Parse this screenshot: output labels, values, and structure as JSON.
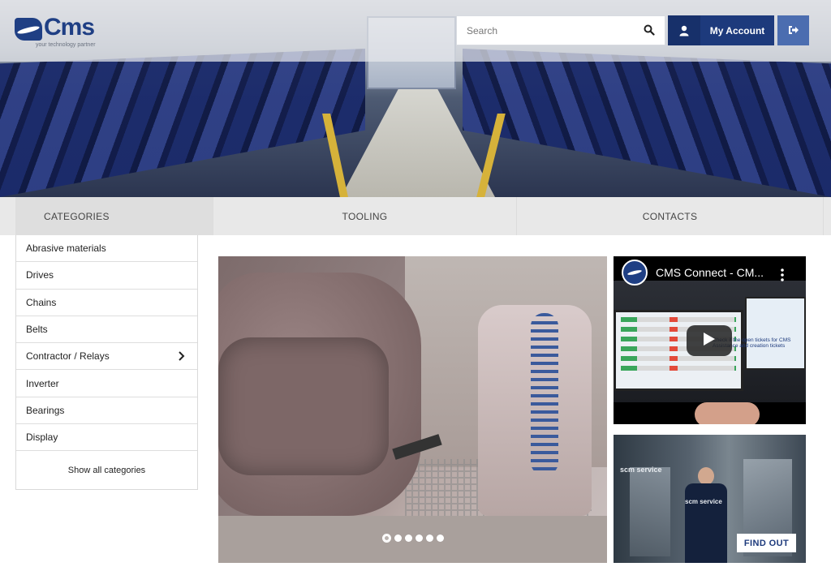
{
  "header": {
    "brand": "Cms",
    "tagline": "your technology partner",
    "search": {
      "placeholder": "Search"
    },
    "account_label": "My Account",
    "colors": {
      "accent": "#1d3a7c",
      "accent_light": "#4b6db0"
    }
  },
  "nav": {
    "categories": "CATEGORIES",
    "tooling": "TOOLING",
    "contacts": "CONTACTS"
  },
  "sidebar": {
    "items": [
      {
        "label": "Abrasive materials"
      },
      {
        "label": "Drives"
      },
      {
        "label": "Chains"
      },
      {
        "label": "Belts"
      },
      {
        "label": "Contractor / Relays",
        "has_submenu": true
      },
      {
        "label": "Inverter"
      },
      {
        "label": "Bearings"
      },
      {
        "label": "Display"
      }
    ],
    "show_all": "Show all categories"
  },
  "carousel": {
    "slides": 6,
    "active": 1
  },
  "video": {
    "title": "CMS Connect - CM...",
    "overlay_text": "Check if the open tickets for CMS Assistance and creation tickets"
  },
  "promo": {
    "brand": "scm service",
    "button": "FIND OUT"
  },
  "icons": {
    "search": "search-icon",
    "user": "user-icon",
    "logout": "logout-icon",
    "chevron": "chevron-right-icon",
    "play": "play-icon",
    "more": "more-vertical-icon"
  }
}
